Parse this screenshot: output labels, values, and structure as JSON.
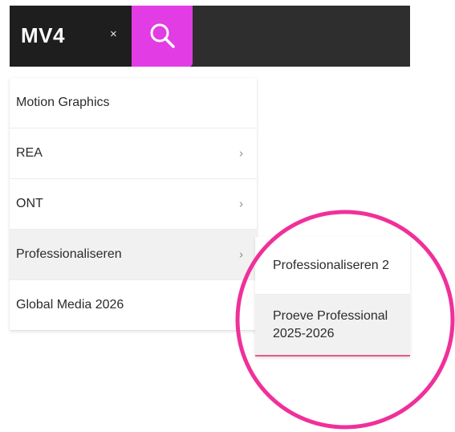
{
  "header": {
    "title": "MV4",
    "close_glyph": "×",
    "search_icon": "search-icon",
    "colors": {
      "bar": "#1e1e1e",
      "search_bg": "#e23ce4"
    }
  },
  "menu": {
    "items": [
      {
        "label": "Motion Graphics",
        "has_submenu": false
      },
      {
        "label": "REA",
        "has_submenu": true,
        "chevron": "›"
      },
      {
        "label": "ONT",
        "has_submenu": true,
        "chevron": "›"
      },
      {
        "label": "Professionaliseren",
        "has_submenu": true,
        "chevron": "›",
        "active": true
      },
      {
        "label": "Global Media 2026",
        "has_submenu": false
      }
    ]
  },
  "submenu": {
    "items": [
      {
        "label": "Professionaliseren 2"
      },
      {
        "label_line1": "Proeve Professional",
        "label_line2": "2025-2026"
      }
    ]
  },
  "highlight": {
    "color": "#f0309a"
  }
}
